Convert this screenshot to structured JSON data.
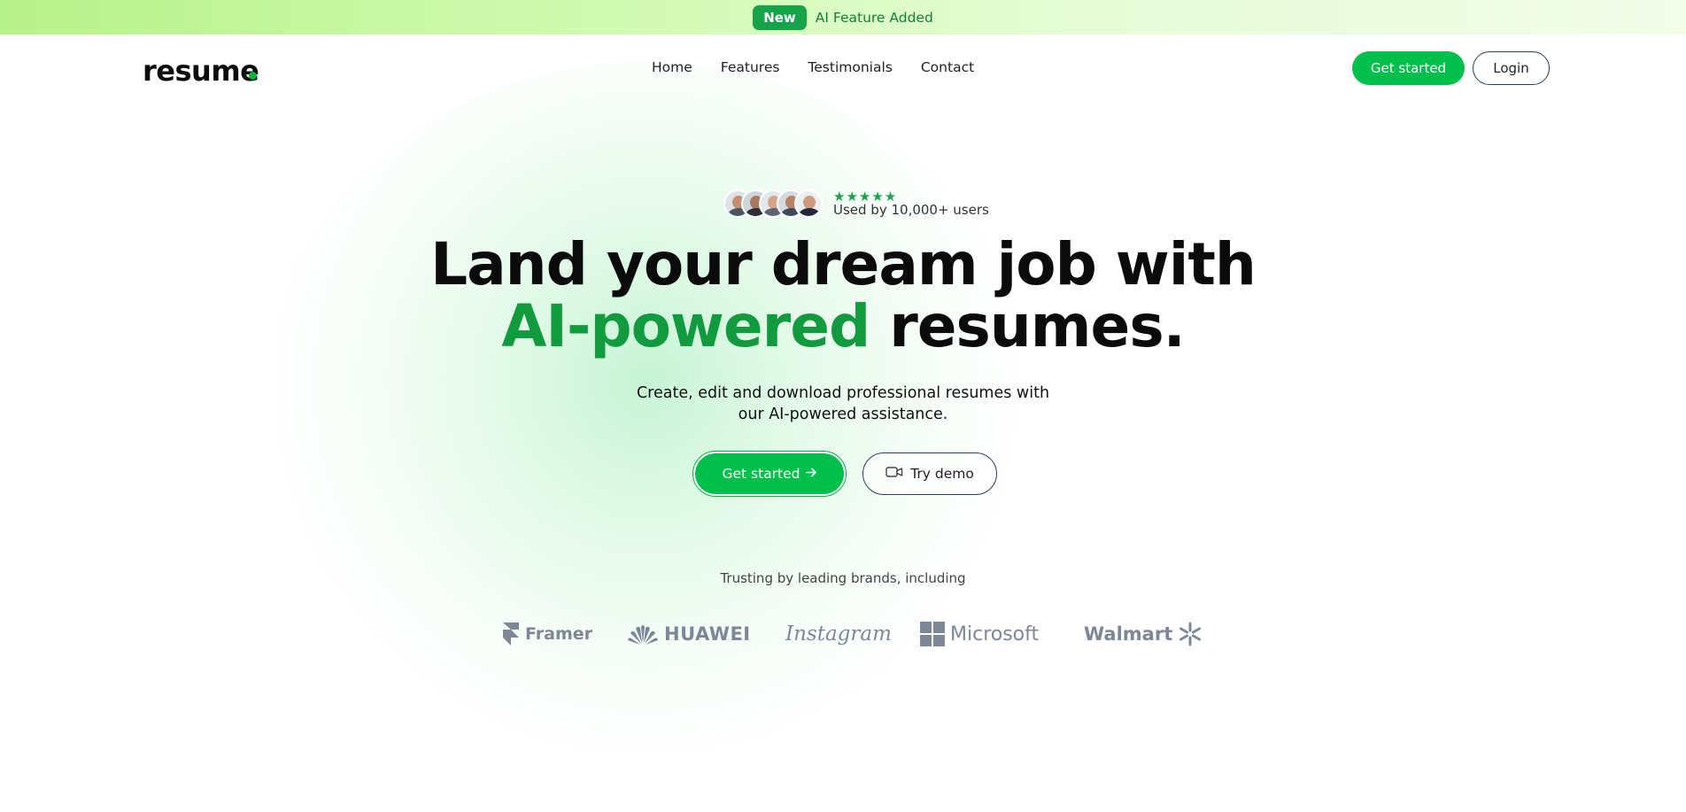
{
  "announcement": {
    "badge": "New",
    "message": "AI Feature Added"
  },
  "header": {
    "logo": "resume",
    "nav": [
      "Home",
      "Features",
      "Testimonials",
      "Contact"
    ],
    "get_started": "Get started",
    "login": "Login"
  },
  "hero": {
    "rating_stars": "★★★★★",
    "used_by": "Used by 10,000+ users",
    "headline_line1": "Land your dream job with",
    "headline_accent": "AI-powered",
    "headline_rest": " resumes.",
    "subtitle_line1": "Create, edit and download professional resumes with",
    "subtitle_line2": "our AI-powered assistance.",
    "cta_primary": "Get started",
    "cta_secondary": "Try demo"
  },
  "brands": {
    "caption": "Trusting by leading brands, including",
    "logos": [
      "Framer",
      "HUAWEI",
      "Instagram",
      "Microsoft",
      "Walmart"
    ]
  },
  "colors": {
    "accent": "#00c04b",
    "accent_dark": "#119a3e",
    "brand_gray": "#7d8798"
  }
}
